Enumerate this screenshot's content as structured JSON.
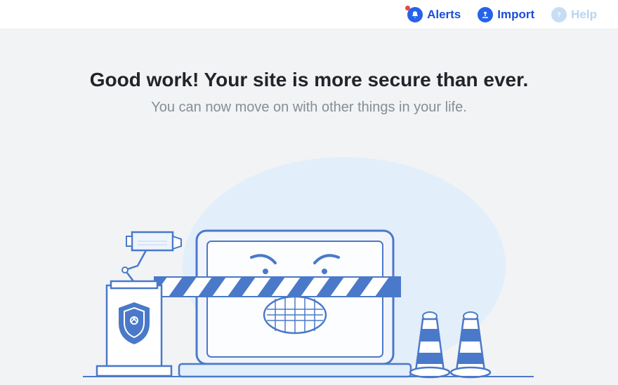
{
  "topbar": {
    "alerts_label": "Alerts",
    "import_label": "Import",
    "help_label": "Help"
  },
  "main": {
    "headline": "Good work! Your site is more secure than ever.",
    "subhead": "You can now move on with other things in your life."
  }
}
